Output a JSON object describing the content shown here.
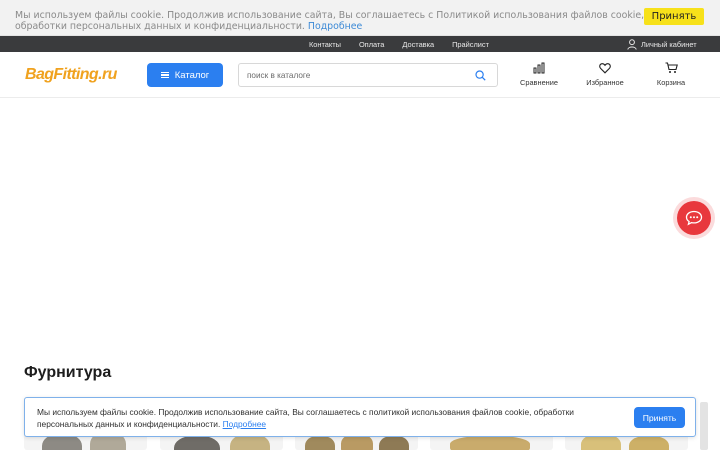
{
  "cookie_top": {
    "text": "Мы используем файлы cookie. Продолжив использование сайта, Вы соглашаетесь с Политикой использования файлов cookie, обработки персональных данных и конфиденциальности.",
    "link": "Подробнее",
    "accept_label": "Принять"
  },
  "topbar": {
    "links": [
      "Контакты",
      "Оплата",
      "Доставка",
      "Прайслист"
    ],
    "account_label": "Личный кабинет"
  },
  "header": {
    "logo": "BagFitting.ru",
    "catalog_label": "Каталог",
    "search_placeholder": "поиск в каталоге",
    "compare_label": "Сравнение",
    "favorites_label": "Избранное",
    "cart_label": "Корзина"
  },
  "section": {
    "title": "Фурнитура"
  },
  "cookie_bottom": {
    "text": "Мы используем файлы cookie. Продолжив использование сайта, Вы соглашаетесь с политикой использования файлов cookie, обработки персональных данных и конфиденциальности.",
    "link": "Подробнее",
    "accept_label": "Принять"
  },
  "colors": {
    "accent": "#2b7ff0",
    "brand": "#f0a21f",
    "cookie_accept": "#f7e11a",
    "topbar": "#3a3b3d",
    "chat": "#e8383d"
  },
  "icons": [
    "user-icon",
    "menu-icon",
    "search-icon",
    "compare-icon",
    "heart-icon",
    "cart-icon",
    "chat-icon"
  ]
}
